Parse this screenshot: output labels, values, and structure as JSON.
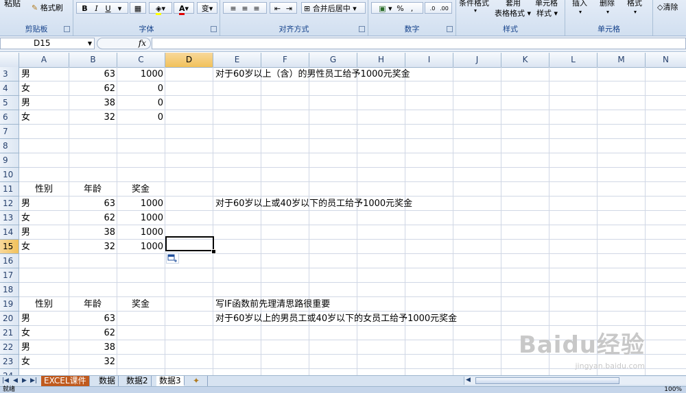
{
  "ribbon": {
    "clipboard": {
      "paste": "粘贴",
      "format_painter": "格式刷",
      "label": "剪贴板"
    },
    "font": {
      "bold": "B",
      "italic": "I",
      "underline": "U",
      "font_color": "A",
      "phonetic": "变",
      "label": "字体"
    },
    "alignment": {
      "merge": "合并后居中",
      "label": "对齐方式"
    },
    "number": {
      "percent": "%",
      "label": "数字"
    },
    "styles": {
      "conditional": "条件格式",
      "table_format_1": "套用",
      "table_format_2": "表格格式",
      "cell_style_1": "单元格",
      "cell_style_2": "样式",
      "label": "样式"
    },
    "cells": {
      "insert": "插入",
      "delete": "删除",
      "format": "格式",
      "label": "单元格"
    },
    "editing": {
      "clear": "清除"
    }
  },
  "formula_bar": {
    "name_box": "D15",
    "fx": "fx",
    "formula": ""
  },
  "columns": [
    "A",
    "B",
    "C",
    "D",
    "E",
    "F",
    "G",
    "H",
    "I",
    "J",
    "K",
    "L",
    "M",
    "N"
  ],
  "selected_column": "D",
  "rows": [
    "3",
    "4",
    "5",
    "6",
    "7",
    "8",
    "9",
    "10",
    "11",
    "12",
    "13",
    "14",
    "15",
    "16",
    "17",
    "18",
    "19",
    "20",
    "21",
    "22",
    "23",
    "24"
  ],
  "selected_row": "15",
  "cells": {
    "r3": {
      "a": "男",
      "b": "63",
      "c": "1000",
      "e": "对于60岁以上（含）的男性员工给予1000元奖金"
    },
    "r4": {
      "a": "女",
      "b": "62",
      "c": "0"
    },
    "r5": {
      "a": "男",
      "b": "38",
      "c": "0"
    },
    "r6": {
      "a": "女",
      "b": "32",
      "c": "0"
    },
    "r11": {
      "a": "性别",
      "b": "年龄",
      "c": "奖金"
    },
    "r12": {
      "a": "男",
      "b": "63",
      "c": "1000",
      "e": "对于60岁以上或40岁以下的员工给予1000元奖金"
    },
    "r13": {
      "a": "女",
      "b": "62",
      "c": "1000"
    },
    "r14": {
      "a": "男",
      "b": "38",
      "c": "1000"
    },
    "r15": {
      "a": "女",
      "b": "32",
      "c": "1000"
    },
    "r19": {
      "a": "性别",
      "b": "年龄",
      "c": "奖金",
      "e": "写IF函数前先理清思路很重要"
    },
    "r20": {
      "a": "男",
      "b": "63",
      "e": "对于60岁以上的男员工或40岁以下的女员工给予1000元奖金"
    },
    "r21": {
      "a": "女",
      "b": "62"
    },
    "r22": {
      "a": "男",
      "b": "38"
    },
    "r23": {
      "a": "女",
      "b": "32"
    }
  },
  "sheet_tabs": [
    "EXCEL课件",
    "数据",
    "数据2",
    "数据3"
  ],
  "active_tab": "数据3",
  "status": {
    "ready": "就绪",
    "zoom": "100%"
  },
  "watermark": {
    "main": "Baidu经验",
    "sub": "jingyan.baidu.com"
  }
}
